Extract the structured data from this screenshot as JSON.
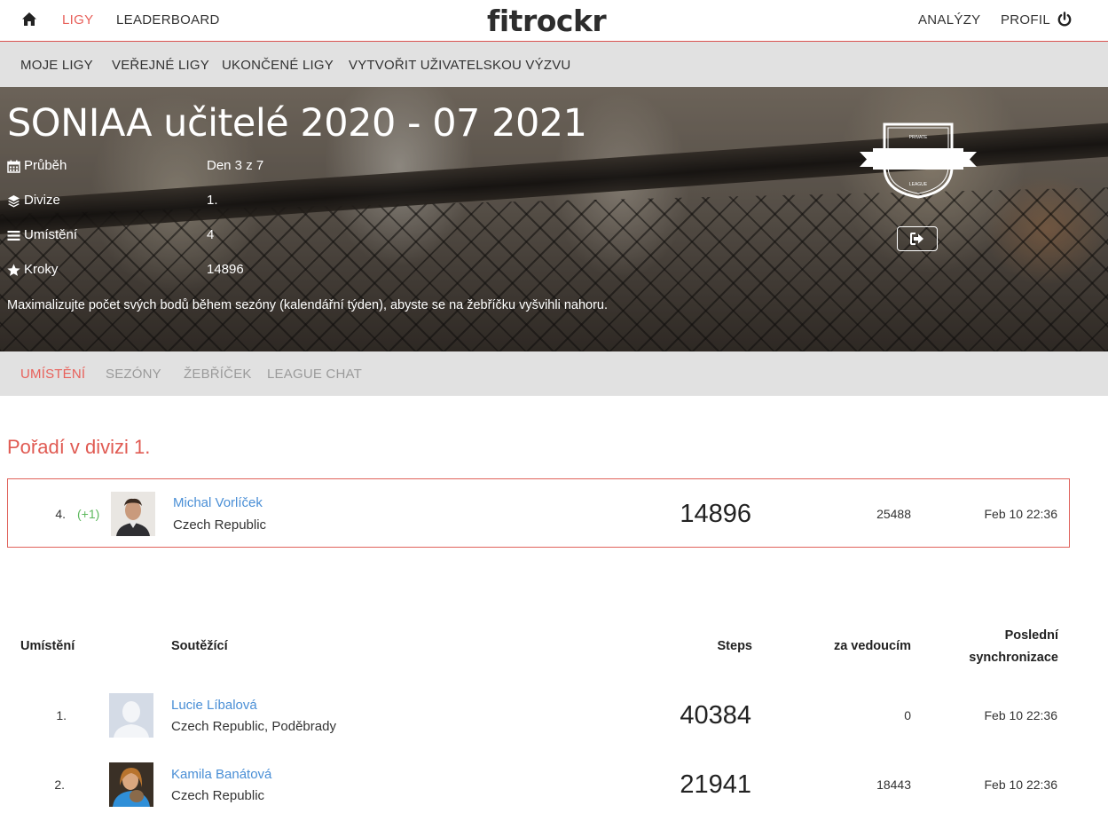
{
  "topnav": {
    "home_icon": "home-icon",
    "links": [
      "LIGY",
      "LEADERBOARD"
    ],
    "logo": "fitrockr",
    "right_links": [
      "ANALÝZY",
      "PROFIL"
    ],
    "power_icon": "power-icon",
    "accent_color": "#e8605a"
  },
  "subnav": [
    "MOJE LIGY",
    "VEŘEJNÉ LIGY",
    "UKONČENÉ LIGY",
    "VYTVOŘIT UŽIVATELSKOU VÝZVU"
  ],
  "league": {
    "title": "SONIAA učitelé 2020 - 07 2021",
    "info": [
      {
        "icon": "calendar-icon",
        "label": "Průběh",
        "value": "Den 3 z 7"
      },
      {
        "icon": "layers-icon",
        "label": "Divize",
        "value": "1."
      },
      {
        "icon": "list-icon",
        "label": "Umístění",
        "value": "4"
      },
      {
        "icon": "star-icon",
        "label": "Kroky",
        "value": "14896"
      }
    ],
    "description": "Maximalizujte počet svých bodů během sezóny (kalendářní týden), abyste se na žebříčku vyšvihli nahoru.",
    "badge": {
      "top_text": "PRIVATE",
      "bottom_text": "LEAGUE"
    },
    "leave_icon": "sign-out-icon"
  },
  "tabs": [
    "UMÍSTĚNÍ",
    "SEZÓNY",
    "ŽEBŘÍČEK",
    "LEAGUE CHAT"
  ],
  "division_title": "Pořadí v divizi 1.",
  "my_entry": {
    "rank": "4.",
    "change": "(+1)",
    "name": "Michal Vorlíček",
    "location": "Czech Republic",
    "steps": "14896",
    "behind": "25488",
    "last_sync": "Feb 10 22:36"
  },
  "table": {
    "headers": {
      "rank": "Umístění",
      "competitor": "Soutěžící",
      "steps": "Steps",
      "behind": "za vedoucím",
      "sync_line1": "Poslední",
      "sync_line2": "synchronizace"
    },
    "rows": [
      {
        "rank": "1.",
        "name": "Lucie Líbalová",
        "location": "Czech Republic, Poděbrady",
        "steps": "40384",
        "behind": "0",
        "last_sync": "Feb 10 22:36"
      },
      {
        "rank": "2.",
        "name": "Kamila Banátová",
        "location": "Czech Republic",
        "steps": "21941",
        "behind": "18443",
        "last_sync": "Feb 10 22:36"
      }
    ]
  }
}
